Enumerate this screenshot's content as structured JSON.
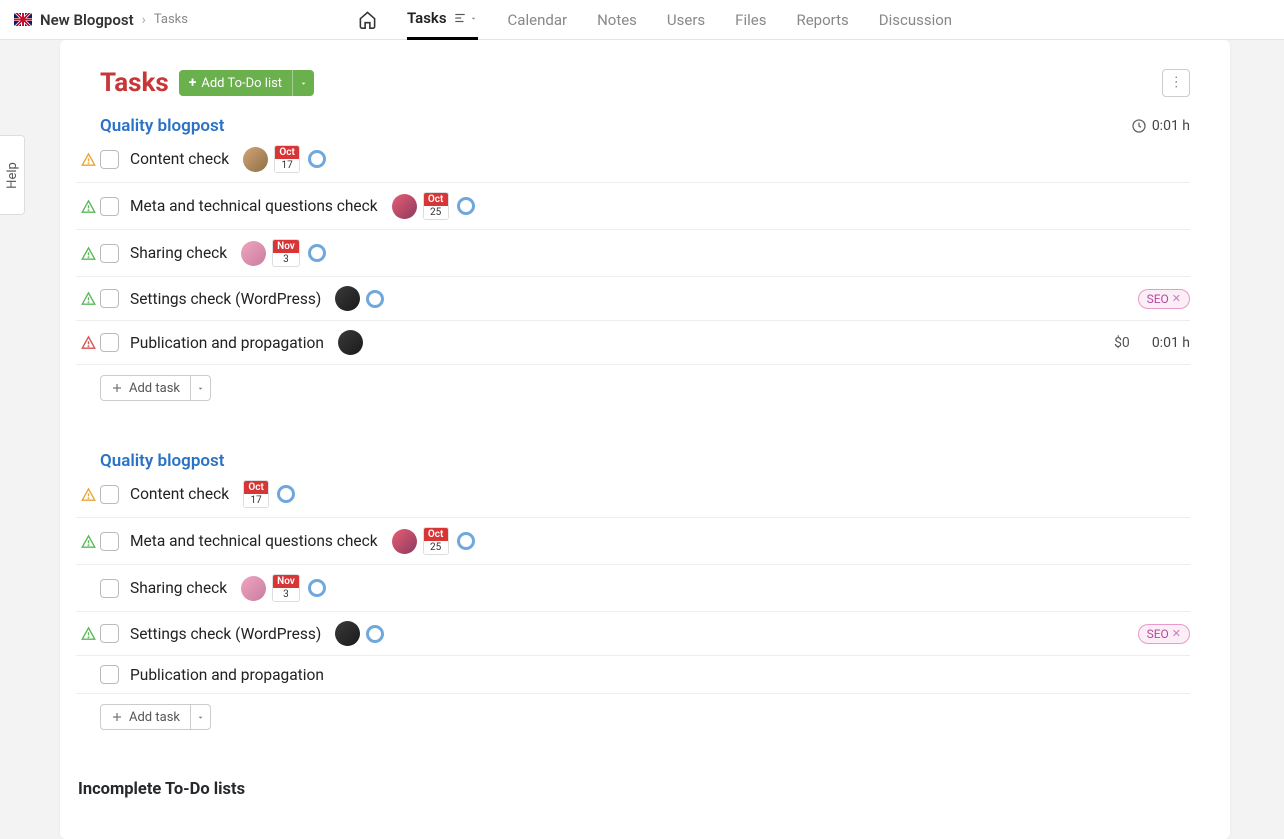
{
  "help_label": "Help",
  "breadcrumb": {
    "project": "New Blogpost",
    "current": "Tasks"
  },
  "nav": {
    "tasks": "Tasks",
    "calendar": "Calendar",
    "notes": "Notes",
    "users": "Users",
    "files": "Files",
    "reports": "Reports",
    "discussion": "Discussion"
  },
  "page_title": "Tasks",
  "add_list_label": "Add To-Do list",
  "add_task_label": "Add task",
  "incomplete_heading": "Incomplete To-Do lists",
  "lists": [
    {
      "title": "Quality blogpost",
      "time": "0:01 h",
      "tasks": [
        {
          "priority": "orange",
          "title": "Content check",
          "avatar": "a1",
          "date_m": "Oct",
          "date_d": "17",
          "ring": true
        },
        {
          "priority": "green",
          "title": "Meta and technical questions check",
          "avatar": "a2",
          "date_m": "Oct",
          "date_d": "25",
          "ring": true
        },
        {
          "priority": "green",
          "title": "Sharing check",
          "avatar": "a3",
          "date_m": "Nov",
          "date_d": "3",
          "ring": true
        },
        {
          "priority": "green",
          "title": "Settings check (WordPress)",
          "avatar": "a4",
          "ring": true,
          "badge": "SEO"
        },
        {
          "priority": "red",
          "title": "Publication and propagation",
          "avatar": "a4",
          "cost": "$0",
          "time": "0:01 h"
        }
      ]
    },
    {
      "title": "Quality blogpost",
      "tasks": [
        {
          "priority": "orange",
          "title": "Content check",
          "date_m": "Oct",
          "date_d": "17",
          "ring": true
        },
        {
          "priority": "green",
          "title": "Meta and technical questions check",
          "avatar": "a2",
          "date_m": "Oct",
          "date_d": "25",
          "ring": true
        },
        {
          "title": "Sharing check",
          "avatar": "a3",
          "date_m": "Nov",
          "date_d": "3",
          "ring": true
        },
        {
          "priority": "green",
          "title": "Settings check (WordPress)",
          "avatar": "a4",
          "ring": true,
          "badge": "SEO"
        },
        {
          "title": "Publication and propagation"
        }
      ]
    }
  ]
}
